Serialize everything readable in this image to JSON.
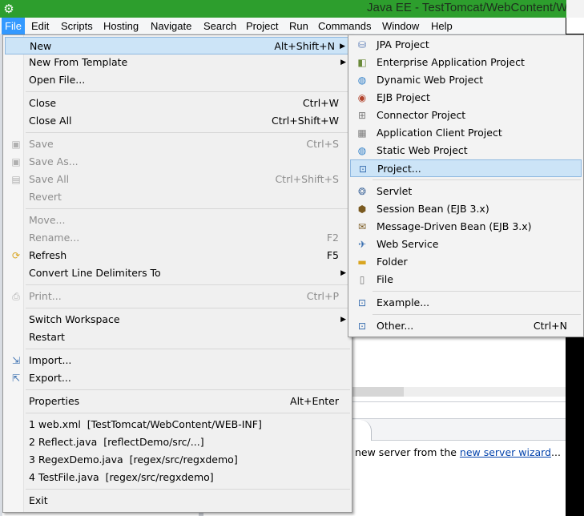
{
  "window": {
    "title": "Java EE - TestTomcat/WebContent/W"
  },
  "menubar": [
    {
      "label": "File",
      "active": true
    },
    {
      "label": "Edit"
    },
    {
      "label": "Scripts"
    },
    {
      "label": "Hosting"
    },
    {
      "label": "Navigate"
    },
    {
      "label": "Search"
    },
    {
      "label": "Project"
    },
    {
      "label": "Run"
    },
    {
      "label": "Commands"
    },
    {
      "label": "Window"
    },
    {
      "label": "Help"
    }
  ],
  "file_menu": {
    "items": [
      {
        "label": "New",
        "accel": "Alt+Shift+N"
      },
      {
        "label": "New From Template"
      },
      {
        "label": "Open File..."
      },
      {
        "label": "Close",
        "accel": "Ctrl+W"
      },
      {
        "label": "Close All",
        "accel": "Ctrl+Shift+W"
      },
      {
        "label": "Save",
        "accel": "Ctrl+S"
      },
      {
        "label": "Save As..."
      },
      {
        "label": "Save All",
        "accel": "Ctrl+Shift+S"
      },
      {
        "label": "Revert"
      },
      {
        "label": "Move..."
      },
      {
        "label": "Rename...",
        "accel": "F2"
      },
      {
        "label": "Refresh",
        "accel": "F5"
      },
      {
        "label": "Convert Line Delimiters To"
      },
      {
        "label": "Print...",
        "accel": "Ctrl+P"
      },
      {
        "label": "Switch Workspace"
      },
      {
        "label": "Restart"
      },
      {
        "label": "Import..."
      },
      {
        "label": "Export..."
      },
      {
        "label": "Properties",
        "accel": "Alt+Enter"
      },
      {
        "label": "1 web.xml  [TestTomcat/WebContent/WEB-INF]"
      },
      {
        "label": "2 Reflect.java  [reflectDemo/src/...]"
      },
      {
        "label": "3 RegexDemo.java  [regex/src/regxdemo]"
      },
      {
        "label": "4 TestFile.java  [regex/src/regxdemo]"
      },
      {
        "label": "Exit"
      }
    ]
  },
  "new_menu": {
    "items": [
      {
        "label": "JPA Project"
      },
      {
        "label": "Enterprise Application Project"
      },
      {
        "label": "Dynamic Web Project"
      },
      {
        "label": "EJB Project"
      },
      {
        "label": "Connector Project"
      },
      {
        "label": "Application Client Project"
      },
      {
        "label": "Static Web Project"
      },
      {
        "label": "Project..."
      },
      {
        "label": "Servlet"
      },
      {
        "label": "Session Bean (EJB 3.x)"
      },
      {
        "label": "Message-Driven Bean (EJB 3.x)"
      },
      {
        "label": "Web Service"
      },
      {
        "label": "Folder"
      },
      {
        "label": "File"
      },
      {
        "label": "Example..."
      },
      {
        "label": "Other...",
        "accel": "Ctrl+N"
      }
    ]
  },
  "workspace": {
    "server_text": "new server from the ",
    "server_link": "new server wizard",
    "server_ellipsis": "..."
  }
}
